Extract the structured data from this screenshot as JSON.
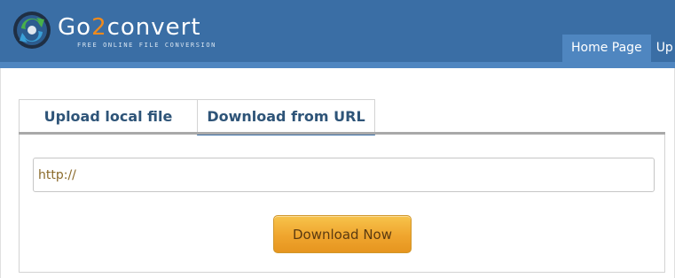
{
  "brand": {
    "title_prefix": "Go",
    "title_accent": "2",
    "title_suffix": "convert",
    "tagline": "FREE ONLINE FILE CONVERSION",
    "logo_icon": "go2convert-logo-icon",
    "colors": {
      "header_bg": "#3a6ea5",
      "accent": "#f08a1c"
    }
  },
  "nav": {
    "items": [
      {
        "label": "Home Page",
        "active": true
      },
      {
        "label": "Up",
        "active": false
      }
    ]
  },
  "tabs": [
    {
      "label": "Upload local file",
      "active": false
    },
    {
      "label": "Download from URL",
      "active": true
    }
  ],
  "url_form": {
    "input_value": "http://",
    "button_label": "Download Now",
    "button_color": "#efa52e"
  }
}
